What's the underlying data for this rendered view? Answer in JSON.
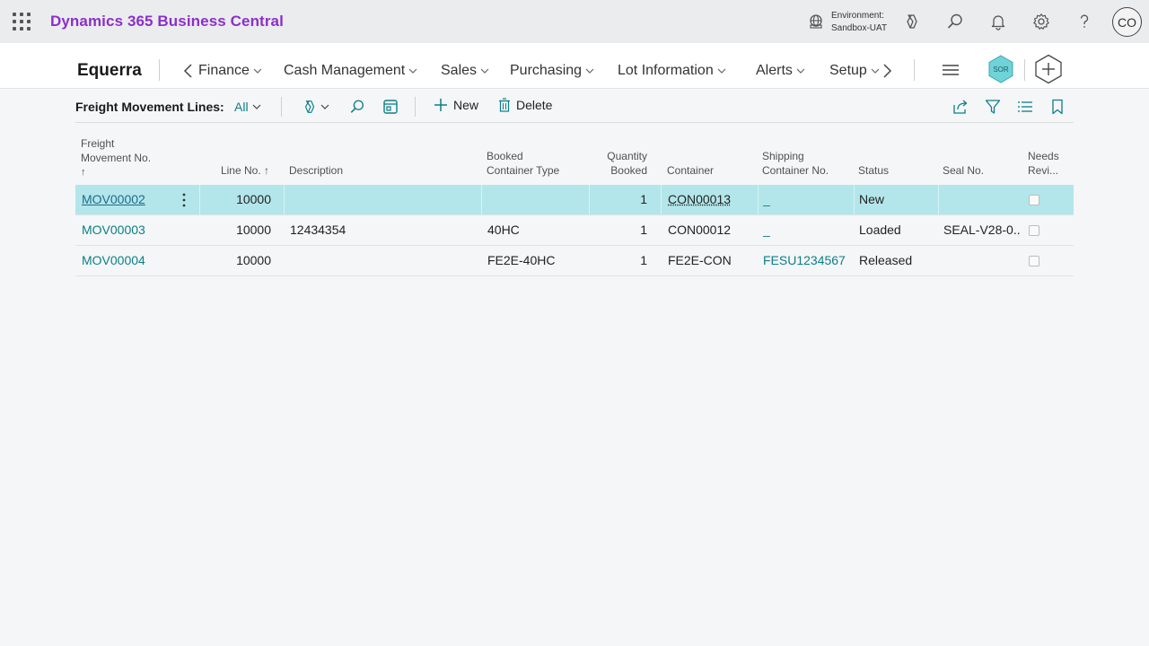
{
  "app": {
    "brand": "Dynamics 365 Business Central",
    "environment_label": "Environment:",
    "environment_name": "Sandbox-UAT",
    "avatar_initials": "CO",
    "accent_color": "#8b2fc9",
    "link_color": "#0a7f86",
    "selected_row_color": "#b3e6ea"
  },
  "nav": {
    "company": "Equerra",
    "items": [
      "Finance",
      "Cash Management",
      "Sales",
      "Purchasing",
      "Lot Information",
      "Alerts",
      "Setup"
    ],
    "badge": "SOR"
  },
  "actions": {
    "caption": "Freight Movement Lines:",
    "view": "All",
    "new_label": "New",
    "delete_label": "Delete"
  },
  "table": {
    "columns": {
      "freight_movement_no_1": "Freight",
      "freight_movement_no_2": "Movement No.",
      "line_no": "Line No.",
      "description": "Description",
      "booked_container_type_1": "Booked",
      "booked_container_type_2": "Container Type",
      "quantity_booked_1": "Quantity",
      "quantity_booked_2": "Booked",
      "container": "Container",
      "shipping_container_no_1": "Shipping",
      "shipping_container_no_2": "Container No.",
      "status": "Status",
      "seal_no": "Seal No.",
      "needs_review_1": "Needs",
      "needs_review_2": "Revi..."
    },
    "rows": [
      {
        "movement_no": "MOV00002",
        "line_no": "10000",
        "description": "",
        "booked_type": "",
        "qty": "1",
        "container": "CON00013",
        "shipping_no": "_",
        "status": "New",
        "seal_no": "",
        "needs_review": false
      },
      {
        "movement_no": "MOV00003",
        "line_no": "10000",
        "description": "12434354",
        "booked_type": "40HC",
        "qty": "1",
        "container": "CON00012",
        "shipping_no": "_",
        "status": "Loaded",
        "seal_no": "SEAL-V28-0...",
        "needs_review": false
      },
      {
        "movement_no": "MOV00004",
        "line_no": "10000",
        "description": "",
        "booked_type": "FE2E-40HC",
        "qty": "1",
        "container": "FE2E-CON",
        "shipping_no": "FESU1234567",
        "status": "Released",
        "seal_no": "",
        "needs_review": false
      }
    ]
  }
}
